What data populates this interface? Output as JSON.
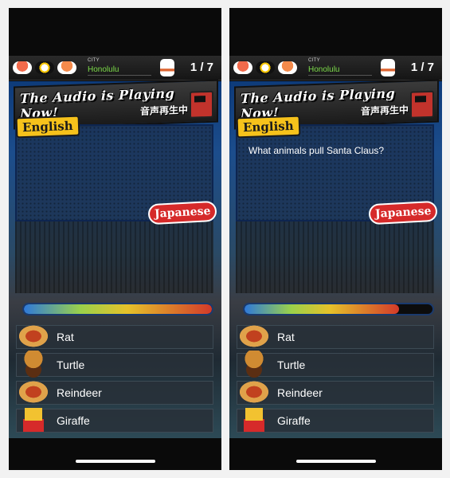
{
  "screens": [
    {
      "city_label": "CITY",
      "city": "Honolulu",
      "progress": "1 / 7",
      "banner_title": "The Audio is Playing Now!",
      "banner_sub": "音声再生中",
      "english_badge": "English",
      "japanese_badge": "Japanese",
      "question": "",
      "timer_fraction": 1.0,
      "answers": [
        "Rat",
        "Turtle",
        "Reindeer",
        "Giraffe"
      ]
    },
    {
      "city_label": "CITY",
      "city": "Honolulu",
      "progress": "1 / 7",
      "banner_title": "The Audio is Playing Now!",
      "banner_sub": "音声再生中",
      "english_badge": "English",
      "japanese_badge": "Japanese",
      "question": "What animals pull Santa Claus?",
      "timer_fraction": 0.82,
      "answers": [
        "Rat",
        "Turtle",
        "Reindeer",
        "Giraffe"
      ]
    }
  ],
  "colors": {
    "accent_green": "#7ddc4a",
    "badge_yellow": "#f6c21b",
    "badge_red": "#d62a2a"
  },
  "icons": [
    "sushi-icon",
    "maneki-neko-icon",
    "radio-icon",
    "hotdog-icon",
    "burger-icon",
    "fries-icon"
  ]
}
